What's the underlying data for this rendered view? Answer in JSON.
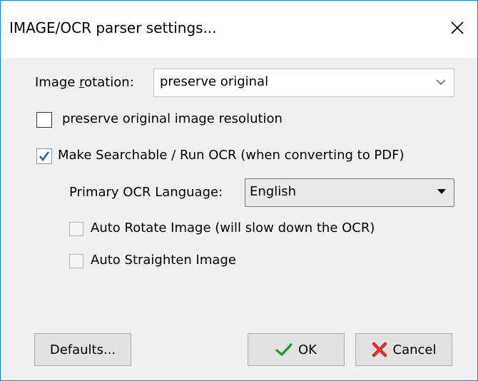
{
  "window": {
    "title": "IMAGE/OCR parser settings..."
  },
  "rotation": {
    "label_prefix": "Image ",
    "label_accel": "r",
    "label_suffix": "otation:",
    "value": "preserve original"
  },
  "preserve_resolution": {
    "label": "preserve original image resolution",
    "checked": false
  },
  "searchable": {
    "label": "Make Searchable / Run OCR (when converting to PDF)",
    "checked": true
  },
  "ocr_language": {
    "label": "Primary OCR Language:",
    "value": "English"
  },
  "auto_rotate": {
    "label": "Auto Rotate Image (will slow down the OCR)",
    "checked": false
  },
  "auto_straighten": {
    "label": "Auto Straighten Image",
    "checked": false
  },
  "buttons": {
    "defaults": "Defaults...",
    "ok": "OK",
    "cancel": "Cancel"
  },
  "colors": {
    "window_border": "#1883d7",
    "dialog_bg": "#f0f0f0",
    "check_blue": "#2a5fa8",
    "ok_green": "#1a9a2a",
    "cancel_red": "#d81b1b"
  }
}
